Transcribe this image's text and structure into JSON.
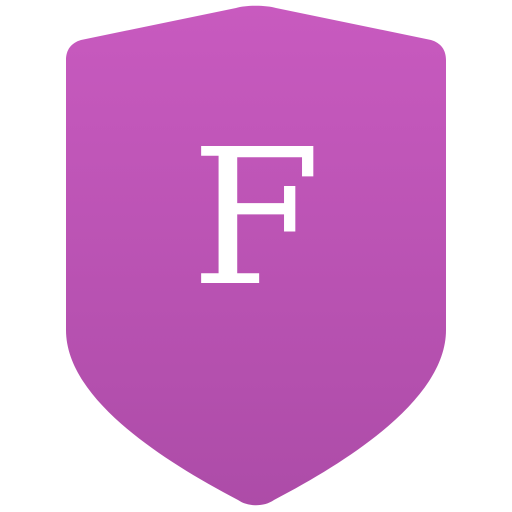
{
  "logo": {
    "letter": "F",
    "icon": "shield-icon",
    "colors": {
      "shield_top": "#C85ABF",
      "shield_bottom": "#AD4CA8",
      "letter": "#FFFFFF",
      "background": "#FFFFFF"
    }
  }
}
